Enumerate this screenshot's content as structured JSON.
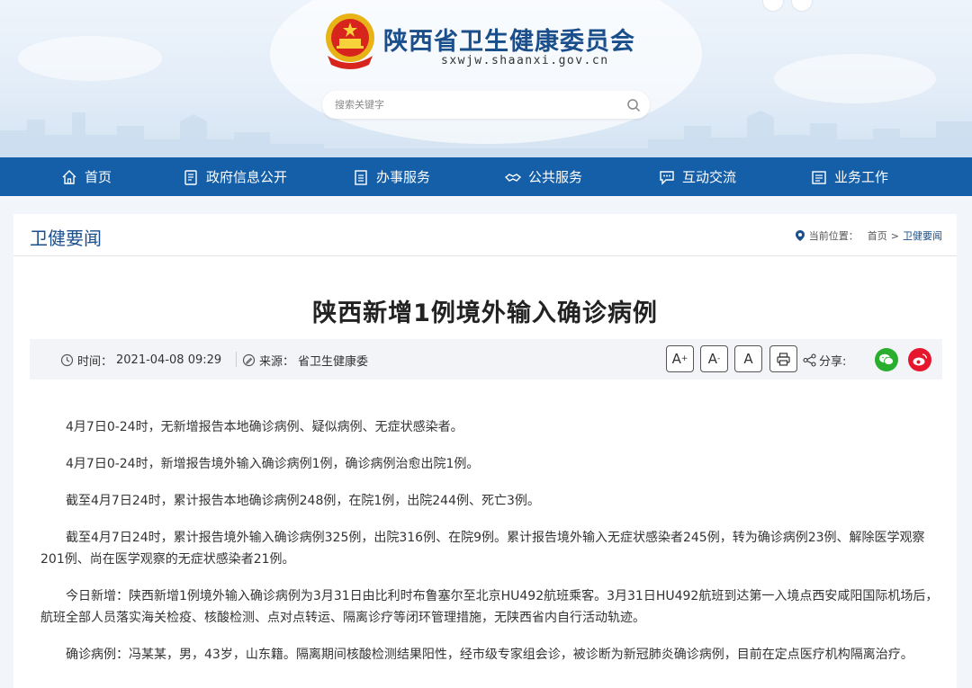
{
  "header": {
    "site_title": "陕西省卫生健康委员会",
    "site_url": "sxwjw.shaanxi.gov.cn",
    "search_placeholder": "搜索关键字"
  },
  "nav": {
    "items": [
      {
        "label": "首页",
        "icon": "home-icon"
      },
      {
        "label": "政府信息公开",
        "icon": "document-list-icon"
      },
      {
        "label": "办事服务",
        "icon": "clipboard-icon"
      },
      {
        "label": "公共服务",
        "icon": "handshake-icon"
      },
      {
        "label": "互动交流",
        "icon": "chat-bubble-icon"
      },
      {
        "label": "业务工作",
        "icon": "briefcase-icon"
      }
    ]
  },
  "section": {
    "title": "卫健要闻",
    "breadcrumb_prefix": "当前位置：",
    "breadcrumb_home": "首页",
    "breadcrumb_sep": ">",
    "breadcrumb_current": "卫健要闻"
  },
  "article": {
    "title": "陕西新增1例境外输入确诊病例",
    "time_label": "时间：",
    "time_value": "2021-04-08 09:29",
    "source_label": "来源：",
    "source_value": "省卫生健康委",
    "font_large": "A",
    "font_large_sup": "+",
    "font_small": "A",
    "font_small_sup": "-",
    "font_default": "A",
    "share_label": "分享:",
    "paragraphs": [
      "4月7日0-24时，无新增报告本地确诊病例、疑似病例、无症状感染者。",
      "4月7日0-24时，新增报告境外输入确诊病例1例，确诊病例治愈出院1例。",
      "截至4月7日24时，累计报告本地确诊病例248例，在院1例，出院244例、死亡3例。",
      "截至4月7日24时，累计报告境外输入确诊病例325例，出院316例、在院9例。累计报告境外输入无症状感染者245例，转为确诊病例23例、解除医学观察201例、尚在医学观察的无症状感染者21例。",
      "今日新增：陕西新增1例境外输入确诊病例为3月31日由比利时布鲁塞尔至北京HU492航班乘客。3月31日HU492航班到达第一入境点西安咸阳国际机场后，航班全部人员落实海关检疫、核酸检测、点对点转运、隔离诊疗等闭环管理措施，无陕西省内自行活动轨迹。",
      "确诊病例：冯某某，男，43岁，山东籍。隔离期间核酸检测结果阳性，经市级专家组会诊，被诊断为新冠肺炎确诊病例，目前在定点医疗机构隔离治疗。"
    ]
  },
  "colors": {
    "nav_bg": "#145fa8",
    "title_blue": "#1a4f8b",
    "wechat_green": "#2aae2e",
    "weibo_red": "#e6162d"
  }
}
